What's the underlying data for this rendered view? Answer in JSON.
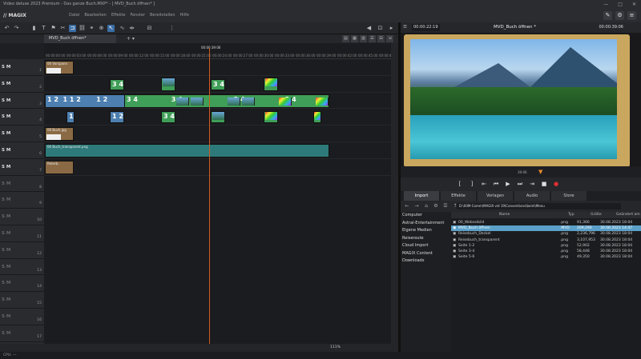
{
  "window": {
    "title": "Video deluxe 2023 Premium - Das ganze Buch.MXP* - [ MVD_Buch öffnen* ]",
    "controls": [
      "—",
      "□",
      "✕"
    ]
  },
  "menubar": {
    "logo": "// MAGIX",
    "items": [
      "Datei",
      "Bearbeiten",
      "Effekte",
      "Fenster",
      "Bereitstellen",
      "Hilfe"
    ]
  },
  "timeline": {
    "tab": "MVD_Buch öffnen*",
    "tab_plus": "+ ▾",
    "ruler_times": [
      "00:00:00:00",
      "00:00:03:00",
      "00:00:06:00",
      "00:00:09:00",
      "00:00:12:00",
      "00:00:15:00",
      "00:00:18:00",
      "00:00:21:00",
      "00:00:24:00",
      "00:00:27:00",
      "00:00:30:00",
      "00:00:33:00",
      "00:00:36:00",
      "00:00:39:00",
      "00:00:42:00",
      "00:00:45:00",
      "00:00:48:00"
    ],
    "playhead_time": "00:00:39:06",
    "track_numbers": [
      "1",
      "2",
      "3",
      "4",
      "5",
      "6",
      "7",
      "8",
      "9",
      "10",
      "11",
      "12",
      "13",
      "14",
      "15",
      "16",
      "17"
    ],
    "track_prefix": "S M",
    "clip_labels": {
      "c1": "00 Vorspann",
      "c5": "00 Buch.jpg",
      "c6": "00 Buch_transparent.png",
      "c7": "Reiseb..",
      "c3a": "1 2",
      "c3b": "Sonnenuntergang",
      "c3c": "0 Bus"
    },
    "zoom_label": "111%"
  },
  "monitor": {
    "timecode_left": "00:00:22:19",
    "title": "MVD_Buch öffnen *",
    "timecode_right": "00:00:39:06",
    "mini_time": "39:06"
  },
  "transport": [
    "[",
    "]",
    "⇤",
    "⏮",
    "▶",
    "⏭",
    "⇥",
    "■",
    "●"
  ],
  "browser": {
    "tabs": [
      "Import",
      "Effekte",
      "Vorlagen",
      "Audio",
      "Store"
    ],
    "path": "D:\\00M-Comm\\MAGIX vid 19\\Conventions\\beim\\Menu",
    "sidebar": [
      "Computer",
      "Astral-Entertainment",
      "Eigene Medien",
      "Reiseroute",
      "Cloud Import",
      "MAGIX Content",
      "Downloads"
    ],
    "columns": [
      "Name",
      "Typ",
      "Größe",
      "Geändert am"
    ],
    "files": [
      {
        "name": "00_Webseibild",
        "type": ".png",
        "size": "91,366",
        "date": "30.08.2023 18:04"
      },
      {
        "name": "MVD_Buch öffnen",
        "type": ".MVD",
        "size": "209,290",
        "date": "30.08.2023 14:47"
      },
      {
        "name": "Reisebuch_Deckel",
        "type": ".png",
        "size": "2,236,796",
        "date": "30.08.2023 18:04"
      },
      {
        "name": "Reisebuch_transparent",
        "type": ".png",
        "size": "3,107,953",
        "date": "30.08.2023 18:04"
      },
      {
        "name": "Seite 1-2",
        "type": ".png",
        "size": "52,902",
        "date": "30.08.2023 18:04"
      },
      {
        "name": "Seite 3-4",
        "type": ".png",
        "size": "58,448",
        "date": "30.08.2023 18:04"
      },
      {
        "name": "Seite 5-6",
        "type": ".png",
        "size": "49,350",
        "date": "30.08.2023 18:04"
      }
    ]
  },
  "status": {
    "text": "CPU: —"
  },
  "colors": {
    "accent": "#3b6ea5",
    "playhead": "#d35a22",
    "selected_row": "#5aa0c8"
  }
}
